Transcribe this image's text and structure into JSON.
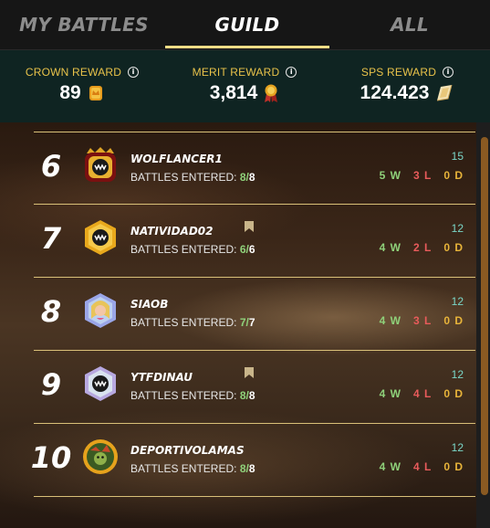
{
  "tabs": [
    {
      "label": "MY BATTLES",
      "active": false
    },
    {
      "label": "GUILD",
      "active": true
    },
    {
      "label": "ALL",
      "active": false
    }
  ],
  "rewards": [
    {
      "label": "CROWN REWARD",
      "value": "89",
      "icon": "crown-reward-icon"
    },
    {
      "label": "MERIT REWARD",
      "value": "3,814",
      "icon": "merit-medal-icon"
    },
    {
      "label": "SPS REWARD",
      "value": "124.423",
      "icon": "sps-token-icon"
    }
  ],
  "battles_label": "BATTLES ENTERED:",
  "players": [
    {
      "rank": "6",
      "name": "WOLFLANCER1",
      "entered": "8",
      "total": "8",
      "points": "15",
      "wins": "5 W",
      "losses": "3 L",
      "draws": "0 D",
      "bookmark": false,
      "avatar": "crown-monster-avatar"
    },
    {
      "rank": "7",
      "name": "NATIVIDAD02",
      "entered": "6",
      "total": "6",
      "points": "12",
      "wins": "4 W",
      "losses": "2 L",
      "draws": "0 D",
      "bookmark": true,
      "avatar": "gold-monster-avatar"
    },
    {
      "rank": "8",
      "name": "SIAOB",
      "entered": "7",
      "total": "7",
      "points": "12",
      "wins": "4 W",
      "losses": "3 L",
      "draws": "0 D",
      "bookmark": false,
      "avatar": "princess-avatar"
    },
    {
      "rank": "9",
      "name": "YTFDINAU",
      "entered": "8",
      "total": "8",
      "points": "12",
      "wins": "4 W",
      "losses": "4 L",
      "draws": "0 D",
      "bookmark": true,
      "avatar": "silver-monster-avatar"
    },
    {
      "rank": "10",
      "name": "DEPORTIVOLAMAS",
      "entered": "8",
      "total": "8",
      "points": "12",
      "wins": "4 W",
      "losses": "4 L",
      "draws": "0 D",
      "bookmark": false,
      "avatar": "goblin-avatar"
    }
  ],
  "colors": {
    "accent_gold": "#f2dc86",
    "reward_label": "#e8c24a",
    "win": "#8fd17a",
    "loss": "#e85b5b",
    "draw": "#e8b43a",
    "points": "#7ad7c8"
  }
}
